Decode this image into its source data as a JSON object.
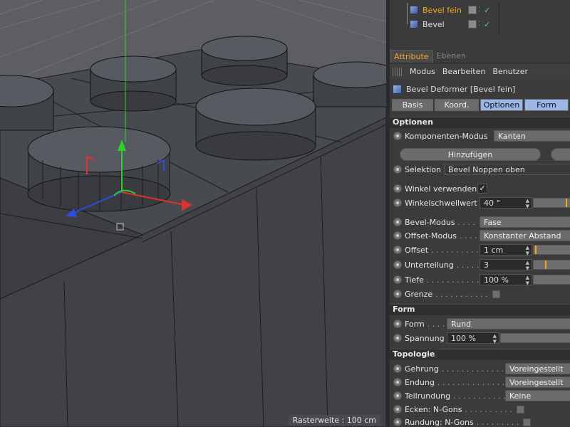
{
  "viewport": {
    "raster_label": "Rasterweite : 100 cm",
    "scene_colors": {
      "studs_top": "#52565c",
      "body": "#3e4045",
      "edges": "#1a1a1a",
      "axis_x": "#e23030",
      "axis_y": "#2bd12b",
      "axis_z": "#2f4ce0"
    }
  },
  "object_manager": {
    "items": [
      {
        "name": "Bevel fein",
        "selected": true
      },
      {
        "name": "Bevel",
        "selected": false
      }
    ]
  },
  "manager_tabs": {
    "attribute": "Attribute",
    "ebenen": "Ebenen"
  },
  "menu": {
    "modus": "Modus",
    "bearbeiten": "Bearbeiten",
    "benutzer": "Benutzer"
  },
  "object_title": "Bevel Deformer [Bevel fein]",
  "sub_tabs": [
    "Basis",
    "Koord.",
    "Optionen",
    "Form"
  ],
  "optionen": {
    "header": "Optionen",
    "komponenten_label": "Komponenten-Modus",
    "komponenten_value": "Kanten",
    "hinzufuegen": "Hinzufügen",
    "selektion_label": "Selektion",
    "selektion_value": "Bevel Noppen oben",
    "winkel_verwenden_label": "Winkel verwenden",
    "winkel_verwenden_value": "✓",
    "winkelschwellwert_label": "Winkelschwellwert",
    "winkelschwellwert_value": "40 °",
    "winkelschwellwert_fraction": 0.85,
    "bevel_modus_label": "Bevel-Modus",
    "bevel_modus_dots": ". . . .",
    "bevel_modus_value": "Fase",
    "offset_modus_label": "Offset-Modus",
    "offset_modus_dots": ". . . .",
    "offset_modus_value": "Konstanter Abstand",
    "offset_label": "Offset",
    "offset_dots": ". . . . . . . . . . .",
    "offset_value": "1 cm",
    "offset_fraction": 0.03,
    "unterteilung_label": "Unterteilung",
    "unterteilung_dots": ". . . . .",
    "unterteilung_value": "3",
    "unterteilung_fraction": 0.3,
    "tiefe_label": "Tiefe",
    "tiefe_dots": ". . . . . . . . . . . . .",
    "tiefe_value": "100 %",
    "grenze_label": "Grenze",
    "grenze_dots": ". . . . . . . . . . ."
  },
  "form": {
    "header": "Form",
    "form_label": "Form",
    "form_dots": ". . . .",
    "form_value": "Rund",
    "spannung_label": "Spannung",
    "spannung_value": "100 %"
  },
  "topologie": {
    "header": "Topologie",
    "gehrung_label": "Gehrung",
    "gehrung_dots": ". . . . . . . . . . . . . . .",
    "gehrung_value": "Voreingestellt",
    "endung_label": "Endung",
    "endung_dots": ". . . . . . . . . . . . . . . .",
    "endung_value": "Voreingestellt",
    "teilrundung_label": "Teilrundung",
    "teilrundung_dots": ". . . . . . . . . . . . .",
    "teilrundung_value": "Keine",
    "ecken_label": "Ecken: N-Gons",
    "ecken_dots": ". . . . . . . . . .",
    "rundung_label": "Rundung: N-Gons",
    "rundung_dots": ". . . . . . . . ."
  },
  "accent": "#f5a623"
}
